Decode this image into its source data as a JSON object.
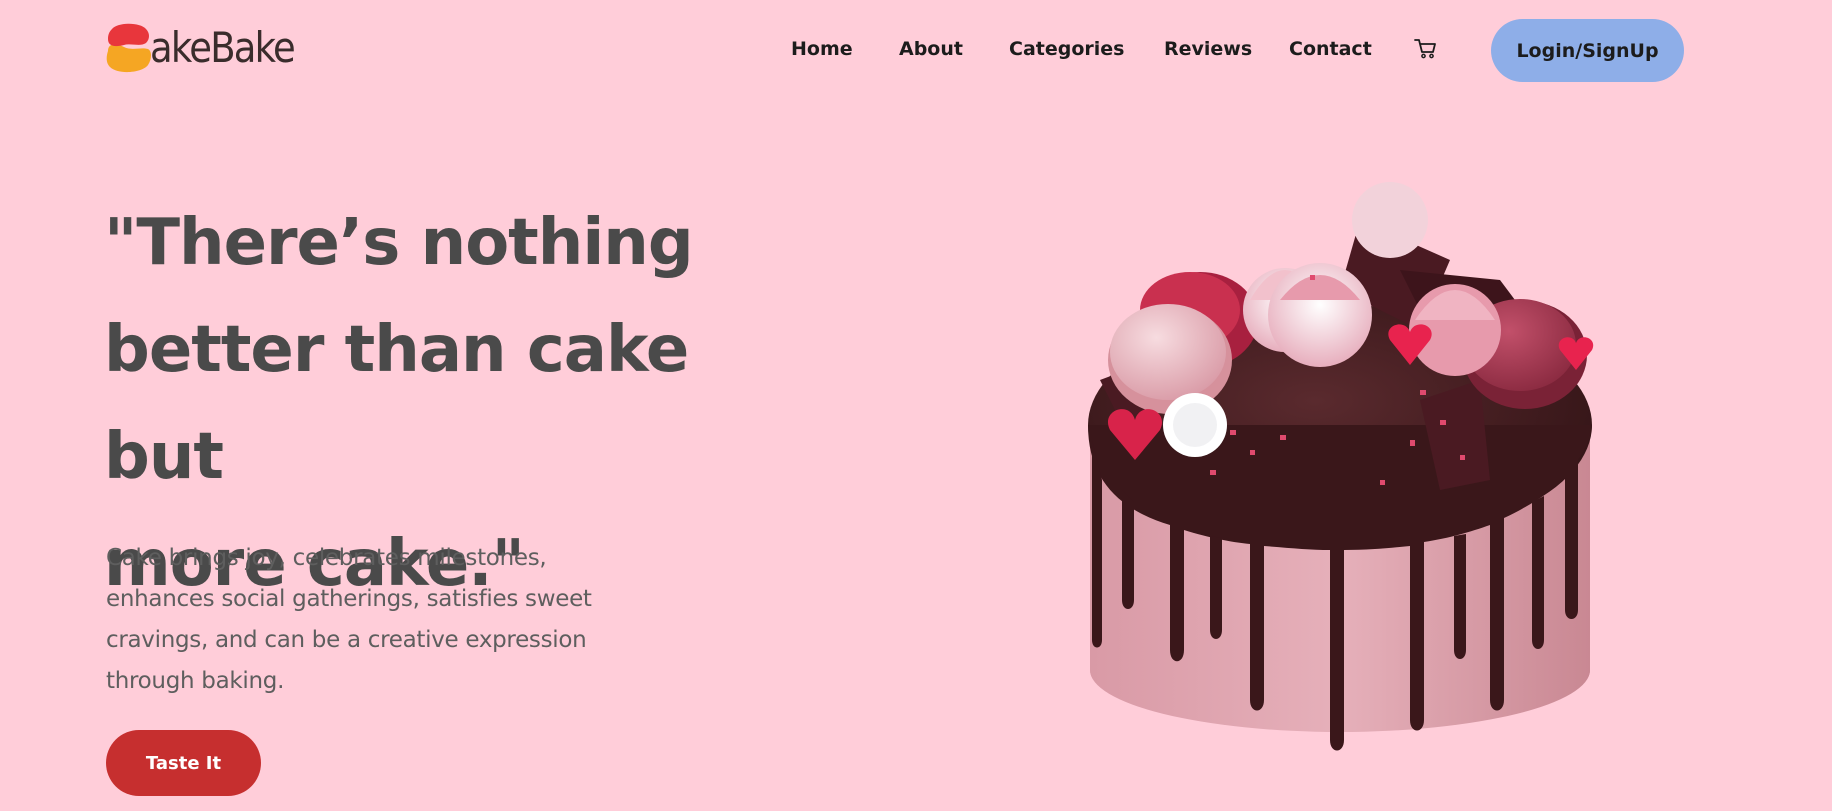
{
  "brand": {
    "logo_text": "akeBake",
    "logo_icon": "cake-logo-mark"
  },
  "nav": {
    "items": [
      {
        "label": "Home"
      },
      {
        "label": "About"
      },
      {
        "label": "Categories"
      },
      {
        "label": "Reviews"
      },
      {
        "label": "Contact"
      }
    ],
    "cart_icon": "cart-icon",
    "login_label": "Login/SignUp"
  },
  "hero": {
    "title_lines": [
      "\"There’s nothing",
      "better than cake but",
      "more cake.\""
    ],
    "description_lines": [
      "Cake brings joy, celebrates milestones,",
      "enhances social gatherings, satisfies sweet",
      "cravings, and can be a creative expression",
      "through baking."
    ],
    "cta_label": "Taste It",
    "image": "chocolate-drip-cake-with-macarons"
  },
  "colors": {
    "background": "#ffcdd9",
    "login_button": "#8eaee8",
    "cta_button": "#c62f2f",
    "heading": "#4a4a4a",
    "logo_red": "#e8363c",
    "logo_orange": "#f5a623"
  }
}
